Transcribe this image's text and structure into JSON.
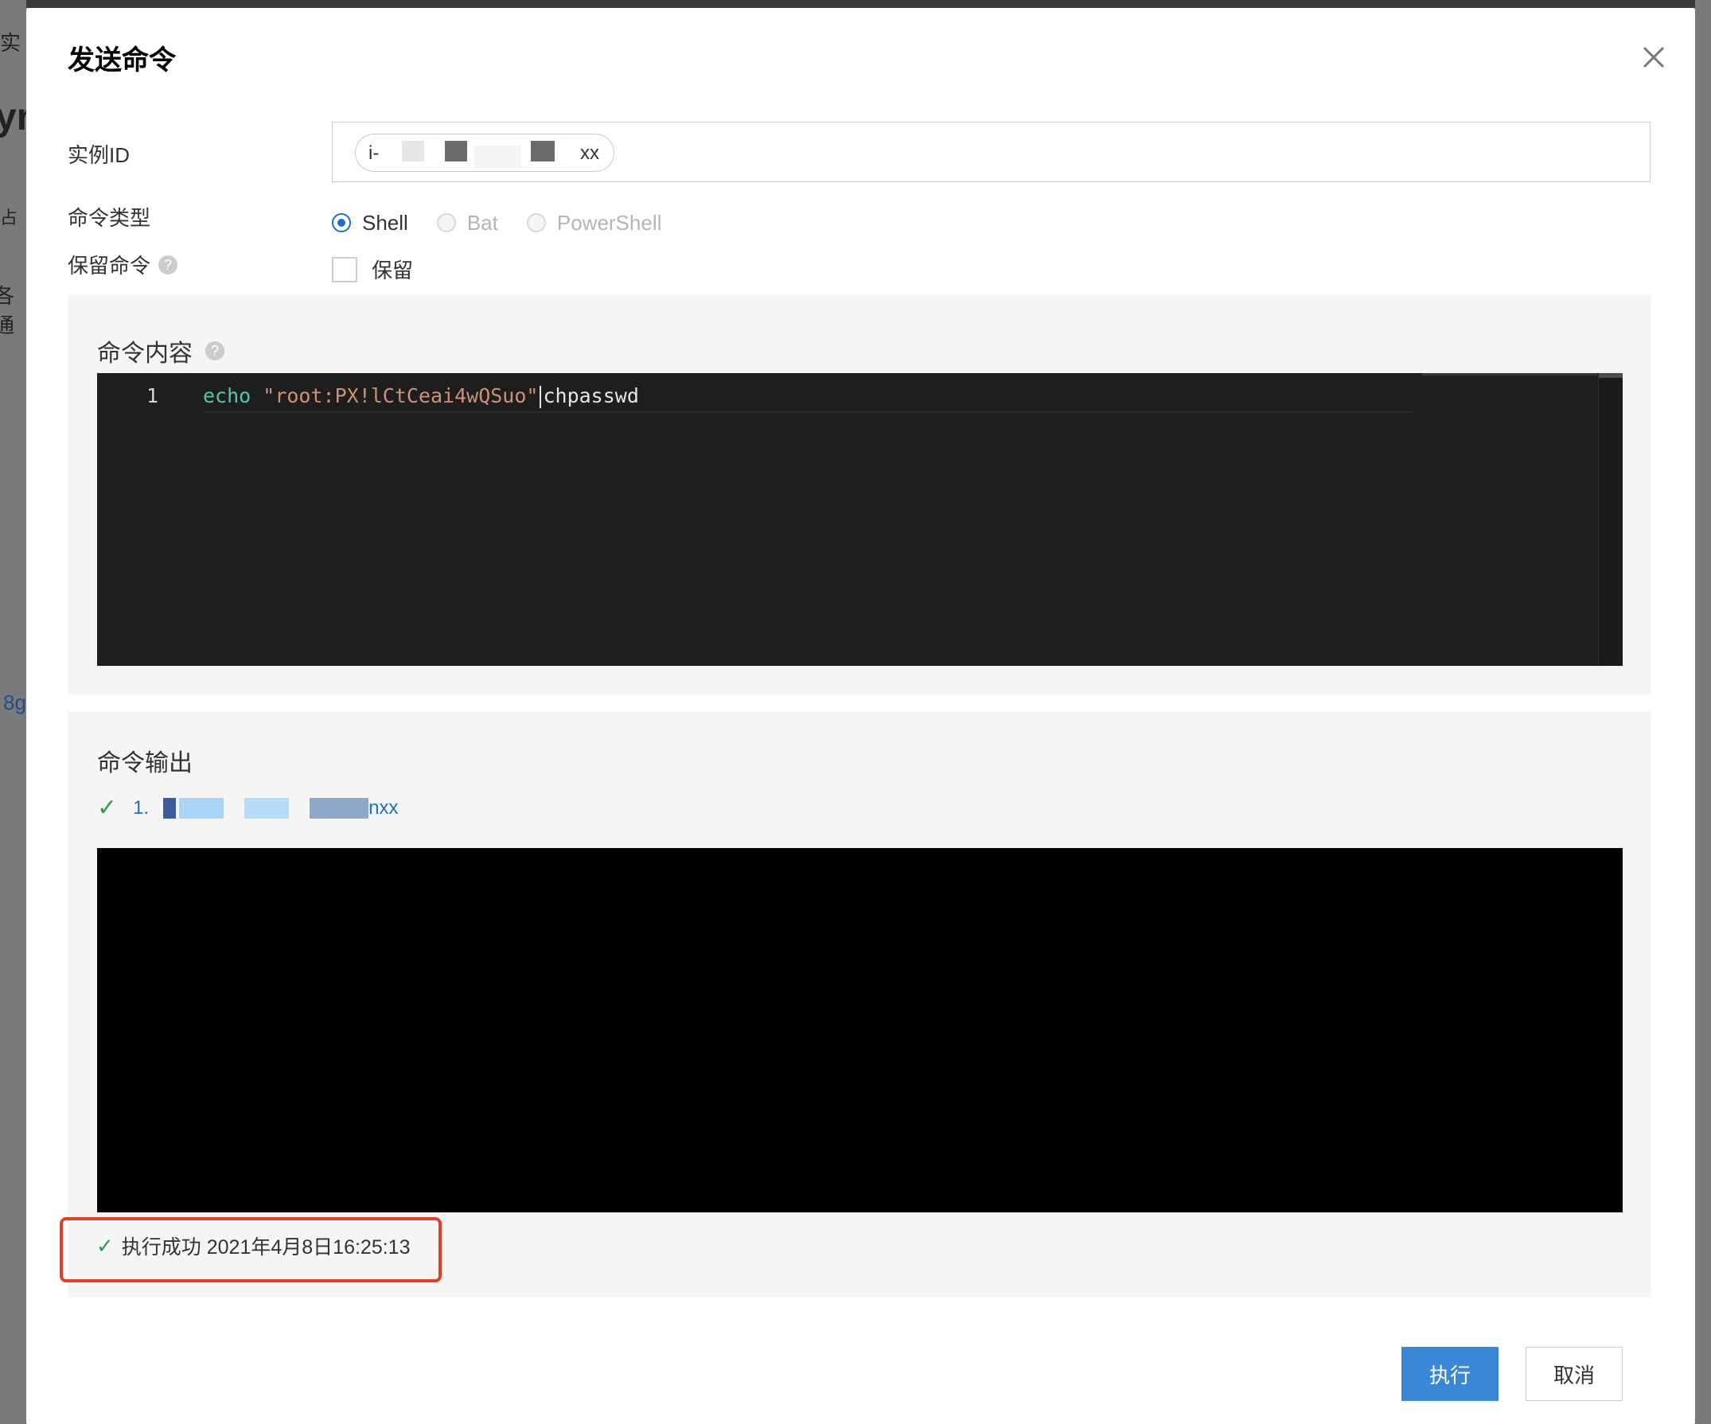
{
  "dialog": {
    "title": "发送命令",
    "close_icon": "close-icon"
  },
  "background": {
    "fragments": [
      "实",
      "yr",
      "占",
      "各通",
      "8g"
    ]
  },
  "form": {
    "instance_id_label": "实例ID",
    "instance_tag_prefix": "i-",
    "instance_tag_suffix": "xx",
    "command_type_label": "命令类型",
    "command_types": [
      {
        "label": "Shell",
        "checked": true,
        "disabled": false
      },
      {
        "label": "Bat",
        "checked": false,
        "disabled": true
      },
      {
        "label": "PowerShell",
        "checked": false,
        "disabled": true
      }
    ],
    "keep_command_label": "保留命令",
    "keep_checkbox_label": "保留",
    "keep_checked": false
  },
  "command_content": {
    "title": "命令内容",
    "line_number": "1",
    "code_keyword": "echo",
    "code_string": "\"root:PX!lCtCeai4wQSuo\"",
    "code_rest": "chpasswd"
  },
  "command_output": {
    "title": "命令输出",
    "item_index": "1.",
    "item_suffix": "nxx"
  },
  "status": {
    "text": "执行成功 2021年4月8日16:25:13"
  },
  "footer": {
    "execute_label": "执行",
    "cancel_label": "取消"
  },
  "colors": {
    "primary": "#3a86d7",
    "success": "#2e9e4b",
    "highlight_border": "#e0402a"
  }
}
